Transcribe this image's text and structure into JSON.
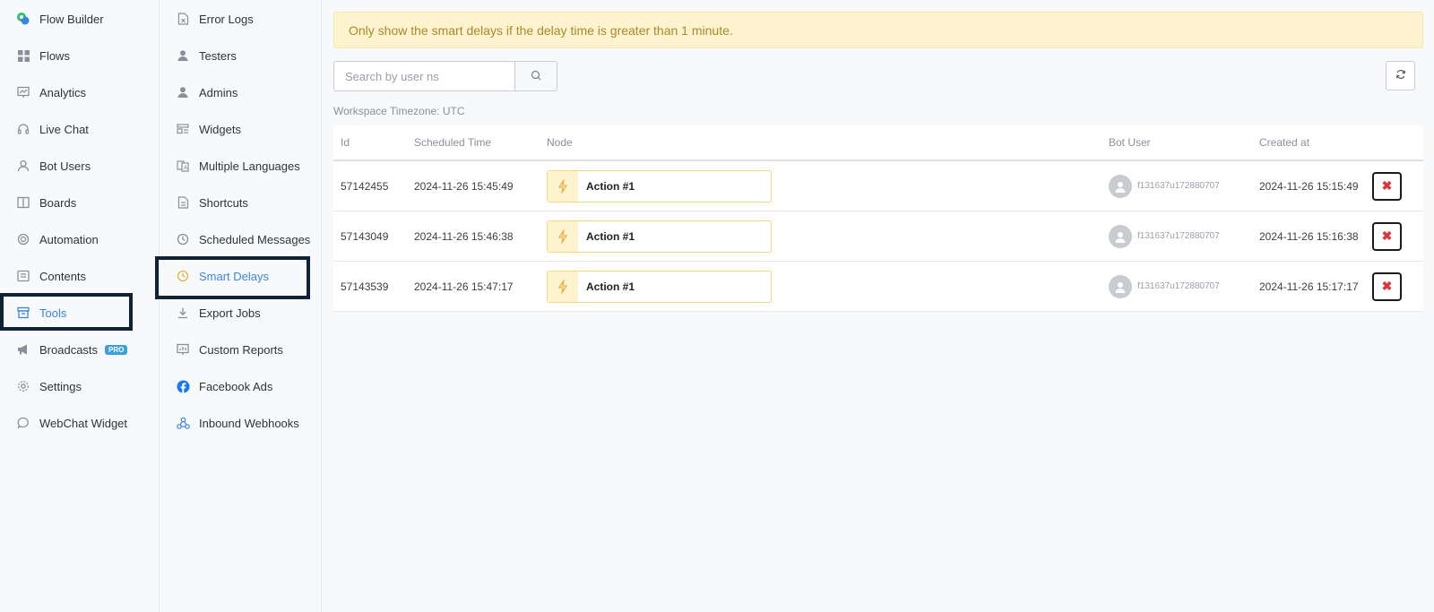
{
  "sidebar": {
    "items": [
      {
        "label": "Flow Builder",
        "icon": "flow-builder-logo-icon"
      },
      {
        "label": "Flows",
        "icon": "grid-icon"
      },
      {
        "label": "Analytics",
        "icon": "chart-board-icon"
      },
      {
        "label": "Live Chat",
        "icon": "headset-icon"
      },
      {
        "label": "Bot Users",
        "icon": "user-icon"
      },
      {
        "label": "Boards",
        "icon": "columns-icon"
      },
      {
        "label": "Automation",
        "icon": "target-icon"
      },
      {
        "label": "Contents",
        "icon": "list-box-icon"
      },
      {
        "label": "Tools",
        "icon": "archive-icon"
      },
      {
        "label": "Broadcasts",
        "icon": "megaphone-icon",
        "badge": "PRO"
      },
      {
        "label": "Settings",
        "icon": "gear-icon"
      },
      {
        "label": "WebChat Widget",
        "icon": "chat-bubble-icon"
      }
    ]
  },
  "subnav": {
    "items": [
      {
        "label": "Error Logs",
        "icon": "file-x-icon"
      },
      {
        "label": "Testers",
        "icon": "person-icon"
      },
      {
        "label": "Admins",
        "icon": "person-icon"
      },
      {
        "label": "Widgets",
        "icon": "widget-icon"
      },
      {
        "label": "Multiple Languages",
        "icon": "language-icon"
      },
      {
        "label": "Shortcuts",
        "icon": "document-icon"
      },
      {
        "label": "Scheduled Messages",
        "icon": "clock-icon"
      },
      {
        "label": "Smart Delays",
        "icon": "clock-icon"
      },
      {
        "label": "Export Jobs",
        "icon": "download-icon"
      },
      {
        "label": "Custom Reports",
        "icon": "report-icon"
      },
      {
        "label": "Facebook Ads",
        "icon": "facebook-icon"
      },
      {
        "label": "Inbound Webhooks",
        "icon": "webhook-icon"
      }
    ]
  },
  "banner": {
    "text": "Only show the smart delays if the delay time is greater than 1 minute."
  },
  "search": {
    "placeholder": "Search by user ns",
    "value": ""
  },
  "timezone": "Workspace Timezone: UTC",
  "table": {
    "headers": {
      "id": "Id",
      "scheduled": "Scheduled Time",
      "node": "Node",
      "bot_user": "Bot User",
      "created": "Created at"
    },
    "rows": [
      {
        "id": "57142455",
        "scheduled": "2024-11-26 15:45:49",
        "node": "Action #1",
        "user": "f131637u172880707",
        "created": "2024-11-26 15:15:49"
      },
      {
        "id": "57143049",
        "scheduled": "2024-11-26 15:46:38",
        "node": "Action #1",
        "user": "f131637u172880707",
        "created": "2024-11-26 15:16:38"
      },
      {
        "id": "57143539",
        "scheduled": "2024-11-26 15:47:17",
        "node": "Action #1",
        "user": "f131637u172880707",
        "created": "2024-11-26 15:17:17"
      }
    ],
    "delete_glyph": "✖"
  },
  "colors": {
    "accent": "#3a86d9",
    "banner_bg": "#fdf3cf",
    "highlight_border": "#0f2238",
    "delete": "#d9363e"
  }
}
